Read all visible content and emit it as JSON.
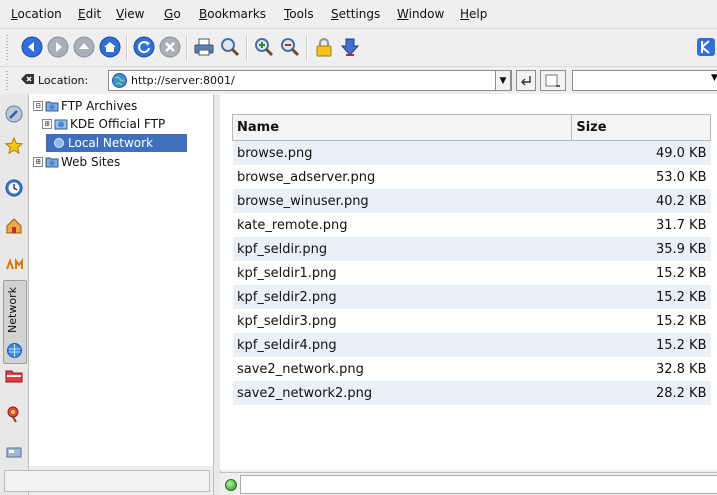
{
  "menu": [
    {
      "label": "Location"
    },
    {
      "label": "Edit"
    },
    {
      "label": "View"
    },
    {
      "label": "Go"
    },
    {
      "label": "Bookmarks"
    },
    {
      "label": "Tools"
    },
    {
      "label": "Settings"
    },
    {
      "label": "Window"
    },
    {
      "label": "Help"
    }
  ],
  "toolbar": {
    "buttons": [
      "back-icon",
      "forward-icon",
      "up-icon",
      "home-icon",
      "reload-icon",
      "stop-icon",
      "print-icon",
      "find-icon",
      "zoom-in-icon",
      "zoom-out-icon",
      "lock-icon",
      "download-icon",
      "kde-icon"
    ]
  },
  "location": {
    "label": "Location:",
    "url": "http://server:8001/"
  },
  "sidebar": {
    "network_tab_label": "Network",
    "tabs": [
      "navigation-icon",
      "bookmarks-icon",
      "history-icon",
      "home-icon",
      "services-icon",
      "network-icon",
      "root-folder-icon",
      "media-icon",
      "special-icon"
    ]
  },
  "tree": {
    "items": [
      {
        "label": "FTP Archives",
        "expander": "⊟"
      },
      {
        "label": "KDE Official FTP",
        "expander": "⊞"
      },
      {
        "label": "Local Network",
        "selected": true
      },
      {
        "label": "Web Sites",
        "expander": "⊞"
      }
    ]
  },
  "files": {
    "columns": [
      "Name",
      "Size"
    ],
    "rows": [
      {
        "name": "browse.png",
        "size": "49.0 KB"
      },
      {
        "name": "browse_adserver.png",
        "size": "53.0 KB"
      },
      {
        "name": "browse_winuser.png",
        "size": "40.2 KB"
      },
      {
        "name": "kate_remote.png",
        "size": "31.7 KB"
      },
      {
        "name": "kpf_seldir.png",
        "size": "35.9 KB"
      },
      {
        "name": "kpf_seldir1.png",
        "size": "15.2 KB"
      },
      {
        "name": "kpf_seldir2.png",
        "size": "15.2 KB"
      },
      {
        "name": "kpf_seldir3.png",
        "size": "15.2 KB"
      },
      {
        "name": "kpf_seldir4.png",
        "size": "15.2 KB"
      },
      {
        "name": "save2_network.png",
        "size": "32.8 KB"
      },
      {
        "name": "save2_network2.png",
        "size": "28.2 KB"
      }
    ]
  },
  "colors": {
    "selection": "#3f6fbf",
    "alt_row": "#eaf0f8",
    "nav_blue": "#2f6fd8"
  }
}
